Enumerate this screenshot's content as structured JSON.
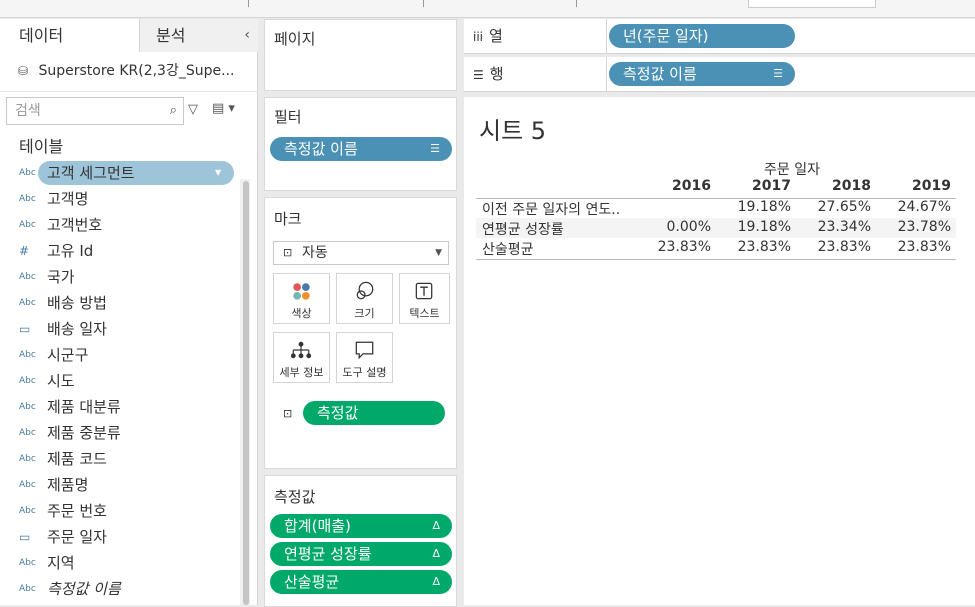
{
  "colors": {
    "pill_blue": "#4a91b5",
    "pill_green": "#00a96a",
    "pill_selected": "#9ec4d9"
  },
  "data_pane": {
    "tab_data": "데이터",
    "tab_analysis": "분석",
    "collapse_icon": "chevron-left-icon",
    "source": "Superstore KR(2,3강_Supe...",
    "search_placeholder": "검색",
    "tables_heading": "테이블",
    "fields": [
      {
        "type": "Abc",
        "label": "고객 세그먼트"
      },
      {
        "type": "Abc",
        "label": "고객명"
      },
      {
        "type": "Abc",
        "label": "고객번호"
      },
      {
        "type": "#",
        "label": "고유 Id"
      },
      {
        "type": "Abc",
        "label": "국가"
      },
      {
        "type": "Abc",
        "label": "배송 방법"
      },
      {
        "type": "calendar",
        "label": "배송 일자"
      },
      {
        "type": "Abc",
        "label": "시군구"
      },
      {
        "type": "Abc",
        "label": "시도"
      },
      {
        "type": "Abc",
        "label": "제품 대분류"
      },
      {
        "type": "Abc",
        "label": "제품 중분류"
      },
      {
        "type": "Abc",
        "label": "제품 코드"
      },
      {
        "type": "Abc",
        "label": "제품명"
      },
      {
        "type": "Abc",
        "label": "주문 번호"
      },
      {
        "type": "calendar",
        "label": "주문 일자"
      },
      {
        "type": "Abc",
        "label": "지역"
      },
      {
        "type": "Abc",
        "label": "측정값 이름"
      }
    ]
  },
  "pages": {
    "title": "페이지"
  },
  "filters": {
    "title": "필터",
    "pill": "측정값 이름"
  },
  "marks": {
    "title": "마크",
    "mark_type": "자동",
    "buttons": {
      "color": "색상",
      "size": "크기",
      "text": "텍스트",
      "detail": "세부 정보",
      "tooltip": "도구 설명"
    },
    "text_pill": "측정값"
  },
  "measure_values": {
    "title": "측정값",
    "pills": [
      "합계(매출)",
      "연평균 성장률",
      "산술평균"
    ]
  },
  "shelves": {
    "columns_label": "열",
    "columns_pill": "년(주문 일자)",
    "rows_label": "행",
    "rows_pill": "측정값 이름"
  },
  "view": {
    "sheet_title": "시트 5",
    "column_header": "주문 일자",
    "years": [
      "2016",
      "2017",
      "2018",
      "2019"
    ],
    "rows": [
      {
        "label": "이전 주문 일자의 연도..",
        "values": [
          "",
          "19.18%",
          "27.65%",
          "24.67%"
        ]
      },
      {
        "label": "연평균 성장률",
        "values": [
          "0.00%",
          "19.18%",
          "23.34%",
          "23.78%"
        ]
      },
      {
        "label": "산술평균",
        "values": [
          "23.83%",
          "23.83%",
          "23.83%",
          "23.83%"
        ]
      }
    ]
  }
}
